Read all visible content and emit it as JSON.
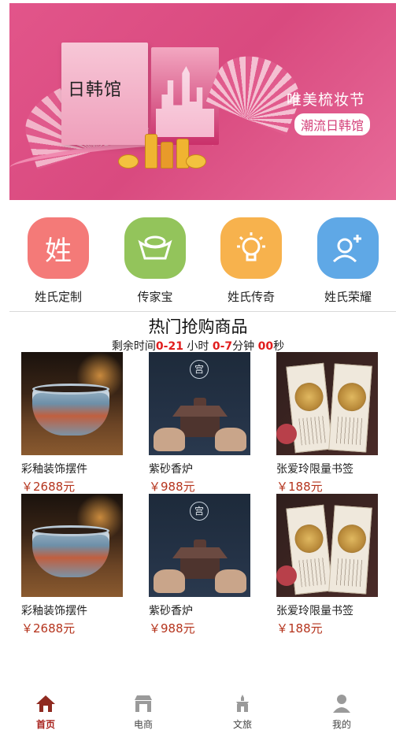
{
  "banner": {
    "box_title": "日韩馆",
    "headline": "唯美梳妆节",
    "tagline": "潮流日韩馆"
  },
  "categories": [
    {
      "label": "姓氏定制",
      "glyph": "姓",
      "color": "#f47a78",
      "icon": "surname-icon"
    },
    {
      "label": "传家宝",
      "glyph": "",
      "color": "#93c45b",
      "icon": "treasure-ingot-icon"
    },
    {
      "label": "姓氏传奇",
      "glyph": "",
      "color": "#f7b24d",
      "icon": "lightbulb-icon"
    },
    {
      "label": "姓氏荣耀",
      "glyph": "",
      "color": "#5fa8e6",
      "icon": "user-star-icon"
    }
  ],
  "hot": {
    "title": "热门抢购商品",
    "countdown": {
      "prefix": "剩余时间",
      "days": "0-21",
      "hours_label": " 小时 ",
      "hours": "0-7",
      "minutes_label": "分钟 ",
      "seconds": "00",
      "seconds_label": "秒"
    }
  },
  "products": [
    {
      "name": "彩釉装饰摆件",
      "price": "￥2688元",
      "image": "glazed-bowl"
    },
    {
      "name": "紫砂香炉",
      "price": "￥988元",
      "image": "incense-burner"
    },
    {
      "name": "张爱玲限量书签",
      "price": "￥188元",
      "image": "bookmark-set"
    },
    {
      "name": "彩釉装饰摆件",
      "price": "￥2688元",
      "image": "glazed-bowl"
    },
    {
      "name": "紫砂香炉",
      "price": "￥988元",
      "image": "incense-burner"
    },
    {
      "name": "张爱玲限量书签",
      "price": "￥188元",
      "image": "bookmark-set"
    }
  ],
  "incense_seal": "宫",
  "nav": [
    {
      "label": "首页",
      "icon": "home-icon",
      "active": true
    },
    {
      "label": "电商",
      "icon": "shop-icon",
      "active": false
    },
    {
      "label": "文旅",
      "icon": "temple-icon",
      "active": false
    },
    {
      "label": "我的",
      "icon": "profile-icon",
      "active": false
    }
  ],
  "colors": {
    "accent_red": "#e11d1d",
    "price_red": "#b5341d",
    "nav_active": "#a8221d",
    "banner_pink": "#d94a7f"
  }
}
